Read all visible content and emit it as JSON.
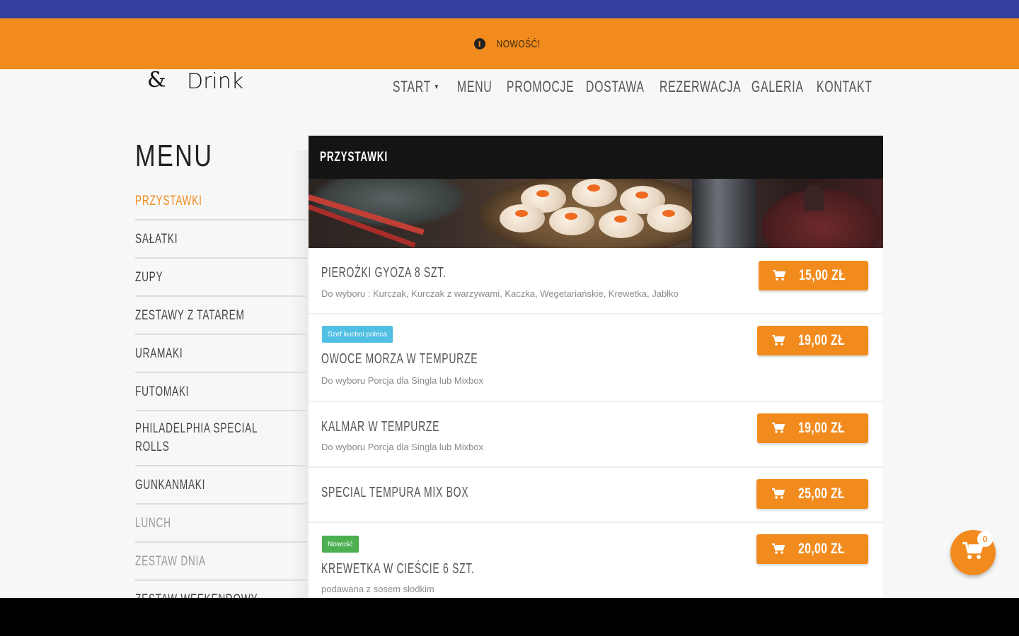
{
  "promo": {
    "icon": "info-icon",
    "text": "NOWOŚĆ!"
  },
  "logo": {
    "amp": "&",
    "drink": "Drink"
  },
  "nav": {
    "items": [
      {
        "label": "START",
        "has_caret": true
      },
      {
        "label": "MENU"
      },
      {
        "label": "PROMOCJE"
      },
      {
        "label": "DOSTAWA"
      },
      {
        "label": "REZERWACJA"
      },
      {
        "label": "GALERIA"
      },
      {
        "label": "KONTAKT"
      }
    ]
  },
  "menu_heading": "MENU",
  "categories": [
    {
      "label": "PRZYSTAWKI",
      "state": "active"
    },
    {
      "label": "SAŁATKI"
    },
    {
      "label": "ZUPY"
    },
    {
      "label": "ZESTAWY Z TATAREM"
    },
    {
      "label": "URAMAKI"
    },
    {
      "label": "FUTOMAKI"
    },
    {
      "label": "PHILADELPHIA SPECIAL ROLLS"
    },
    {
      "label": "GUNKANMAKI"
    },
    {
      "label": "LUNCH",
      "state": "muted"
    },
    {
      "label": "ZESTAW DNIA",
      "state": "muted"
    },
    {
      "label": "ZESTAW WEEKENDOWY"
    }
  ],
  "panel": {
    "title": "PRZYSTAWKI",
    "items": [
      {
        "name": "PIEROŻKI GYOZA 8 SZT.",
        "desc": "Do wyboru : Kurczak, Kurczak z warzywami, Kaczka, Wegetariańskie, Krewetka, Jabłko",
        "price": "15,00 ZŁ",
        "badge": ""
      },
      {
        "name": "OWOCE MORZA W TEMPURZE",
        "desc": "Do wyboru Porcja dla Singla lub Mixbox",
        "price": "19,00 ZŁ",
        "badge": "Szef kuchni poleca",
        "badge_color": "#4fbfe3"
      },
      {
        "name": "KALMAR W TEMPURZE",
        "desc": "Do wyboru Porcja dla Singla lub Mixbox",
        "price": "19,00 ZŁ",
        "badge": ""
      },
      {
        "name": "SPECIAL TEMPURA MIX BOX",
        "desc": "",
        "price": "25,00 ZŁ",
        "badge": ""
      },
      {
        "name": "KREWETKA W CIEŚCIE 6 SZT.",
        "desc": "podawana z sosem słodkim",
        "price": "20,00 ZŁ",
        "badge": "Nowość",
        "badge_color": "#4caf50"
      }
    ]
  },
  "cart": {
    "count": "0",
    "icon": "cart-icon"
  },
  "colors": {
    "accent": "#f28b1e",
    "top_strip": "#323f9c",
    "header_bar": "#151414"
  }
}
